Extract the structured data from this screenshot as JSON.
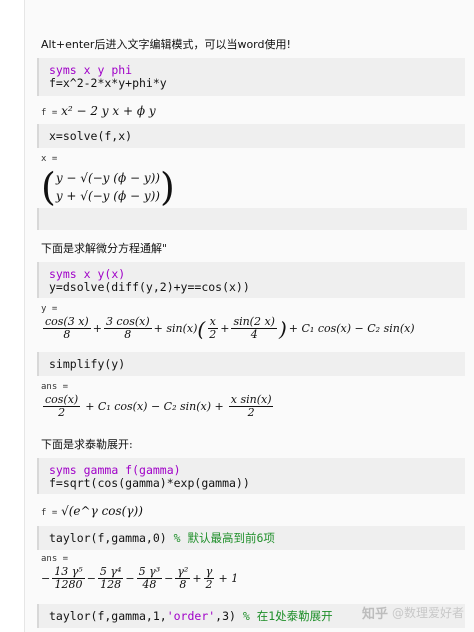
{
  "intro_text": "Alt+enter后进入文字编辑模式，可以当word使用!",
  "cell1": {
    "kw": "syms",
    "vars": " x y phi",
    "line2": "f=x^2-2*x*y+phi*y"
  },
  "out1": {
    "label": "f =",
    "expr": "x² − 2 y x + ϕ y"
  },
  "cell2": {
    "code": "x=solve(f,x)"
  },
  "out2": {
    "label": "x =",
    "row1": "y − √(−y (ϕ − y))",
    "row2": "y + √(−y (ϕ − y))"
  },
  "section2_text": "下面是求解微分方程通解\"",
  "cell3": {
    "kw": "syms",
    "vars": " x y(x)",
    "line2": "y=dsolve(diff(y,2)+y==cos(x))"
  },
  "out3": {
    "label": "y =",
    "f1n": "cos(3 x)",
    "f1d": "8",
    "f2n": "3 cos(x)",
    "f2d": "8",
    "mid": "+ sin(x) ",
    "inner_a": "x",
    "inner_ad": "2",
    "inner_bn": "sin(2 x)",
    "inner_bd": "4",
    "tail": "+ C₁ cos(x) − C₂ sin(x)"
  },
  "cell4": {
    "code": "simplify(y)"
  },
  "out4": {
    "label": "ans =",
    "f1n": "cos(x)",
    "f1d": "2",
    "middle": "+ C₁ cos(x) − C₂ sin(x) +",
    "f2n": "x sin(x)",
    "f2d": "2"
  },
  "section3_text": "下面是求泰勒展开:",
  "cell5": {
    "kw": "syms",
    "vars": " gamma f(gamma)",
    "line2": "f=sqrt(cos(gamma)*exp(gamma))"
  },
  "out5": {
    "label": "f =",
    "expr": "√(e^γ cos(γ))"
  },
  "cell6": {
    "code": "taylor(f,gamma,0) ",
    "comment": "% 默认最高到前6项"
  },
  "out6": {
    "label": "ans =",
    "t1n": "13 γ⁵",
    "t1d": "1280",
    "t2n": "5 γ⁴",
    "t2d": "128",
    "t3n": "5 γ³",
    "t3d": "48",
    "t4n": "γ²",
    "t4d": "8",
    "t5n": "γ",
    "t5d": "2",
    "lead": "−",
    "ops": [
      "−",
      "−",
      "−",
      "+"
    ],
    "end": "+ 1"
  },
  "cell7": {
    "pre": "taylor(f,gamma,1,",
    "str": "'order'",
    "post": ",3) ",
    "comment": "% 在1处泰勒展开"
  },
  "watermark": {
    "brand": "知乎",
    "author": "@数理爱好者"
  }
}
